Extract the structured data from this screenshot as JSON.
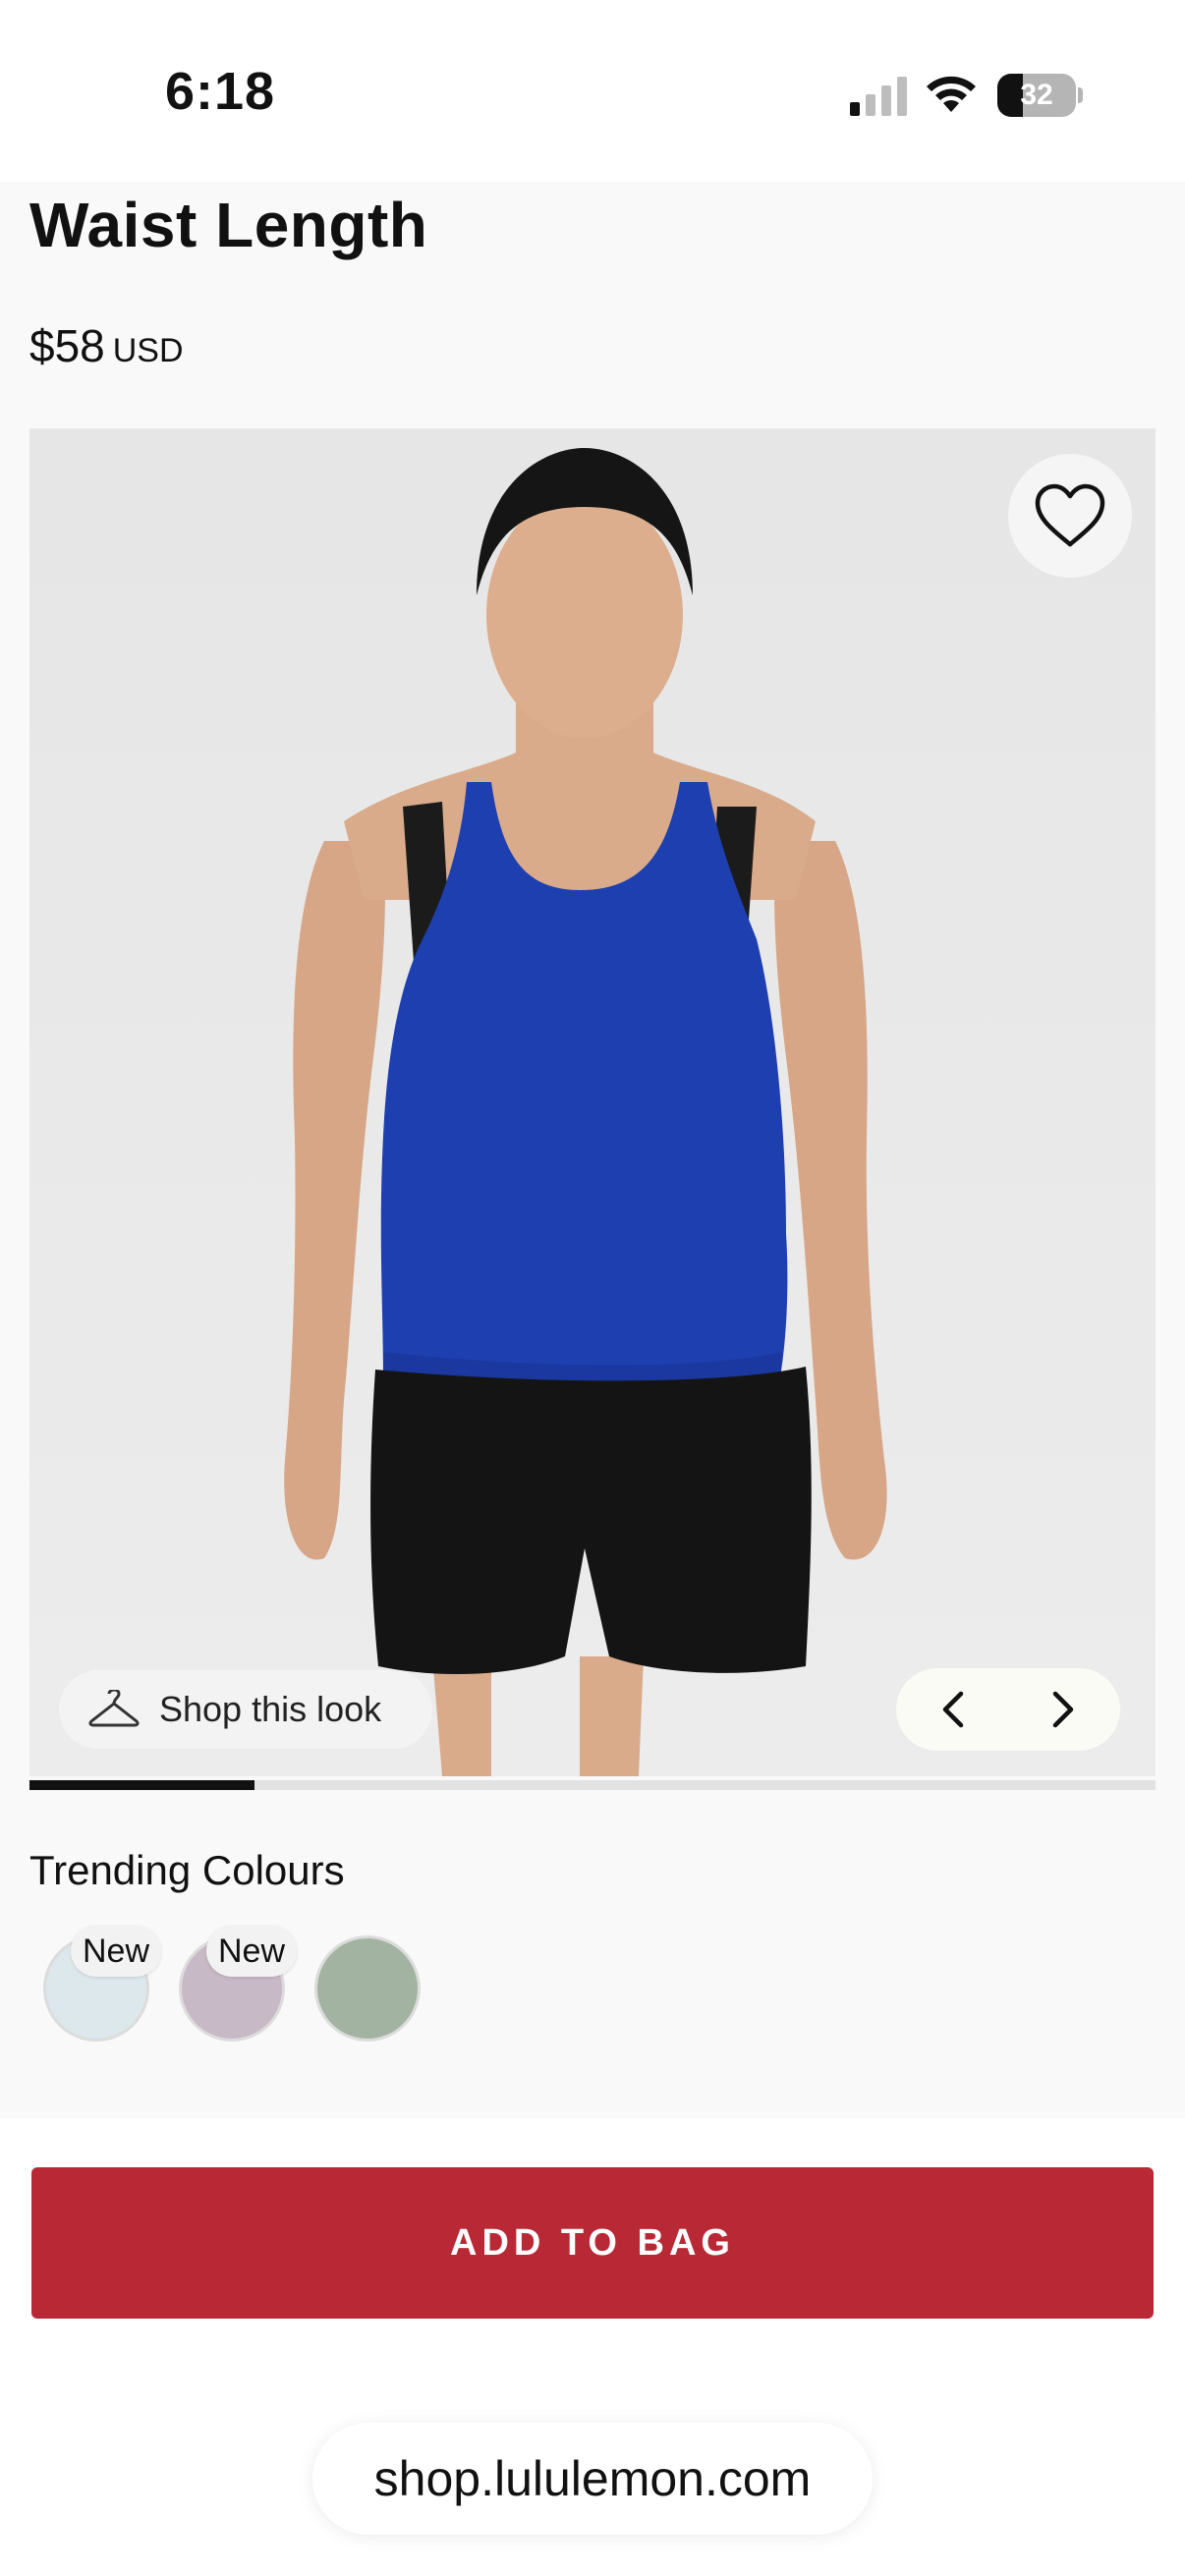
{
  "status_bar": {
    "time": "6:18",
    "battery": "32",
    "battery_level": 0.32
  },
  "product": {
    "title": "Waist Length",
    "price": "$58",
    "currency": "USD"
  },
  "gallery": {
    "shop_this_look_label": "Shop this look",
    "image_progress": 0.2
  },
  "trending": {
    "heading": "Trending Colours",
    "swatches": [
      {
        "badge": "New",
        "color": "#dde8ec"
      },
      {
        "badge": "New",
        "color": "#c8b9c6"
      },
      {
        "badge": "",
        "color": "#a2b3a2"
      }
    ]
  },
  "actions": {
    "add_to_bag_label": "ADD TO BAG"
  },
  "browser": {
    "url": "shop.lululemon.com"
  },
  "colors": {
    "accent": "#b92835",
    "top_blue": "#1e3fb0"
  }
}
